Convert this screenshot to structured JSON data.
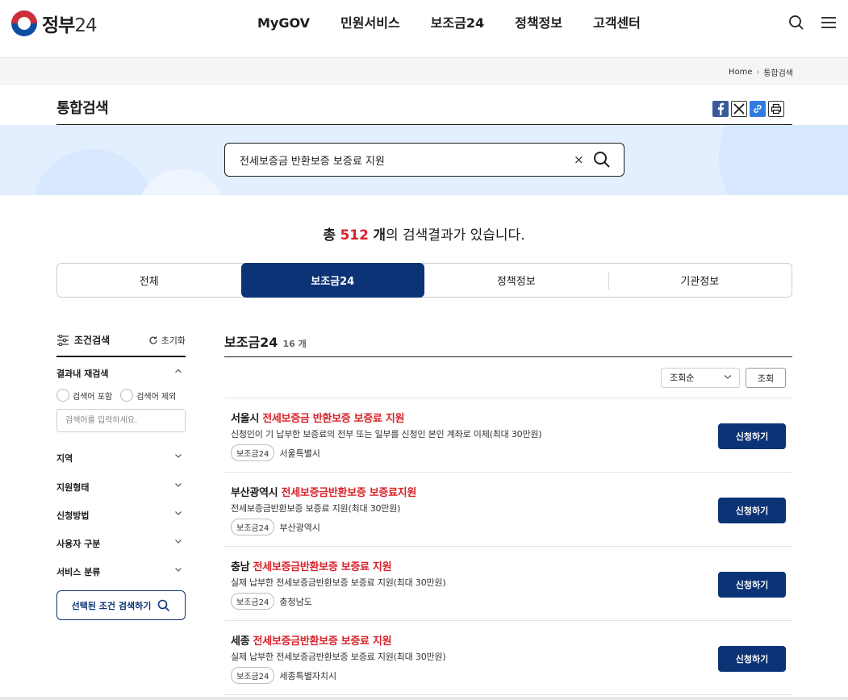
{
  "header": {
    "logo_text": "정부",
    "logo_num": "24",
    "nav": [
      "MyGOV",
      "민원서비스",
      "보조금24",
      "정책정보",
      "고객센터"
    ]
  },
  "breadcrumb": {
    "home": "Home",
    "current": "통합검색"
  },
  "page": {
    "title": "통합검색"
  },
  "search": {
    "query": "전세보증금 반환보증 보증료 지원",
    "clear": "×"
  },
  "result": {
    "prefix": "총",
    "count": "512",
    "unit": "개",
    "suffix": "의 검색결과가 있습니다."
  },
  "tabs": [
    {
      "label": "전체"
    },
    {
      "label": "보조금24"
    },
    {
      "label": "정책정보"
    },
    {
      "label": "기관정보"
    }
  ],
  "filter": {
    "title": "조건검색",
    "reset": "초기화",
    "research_title": "결과내 재검색",
    "include": "검색어 포함",
    "exclude": "검색어 제외",
    "placeholder": "검색어를 입력하세요.",
    "sections": [
      "지역",
      "지원형태",
      "신청방법",
      "사용자 구분",
      "서비스 분류"
    ],
    "submit": "선택된 조건 검색하기"
  },
  "results": {
    "title": "보조금24",
    "count": "16 개",
    "sort_value": "조회순",
    "sort_button": "조회",
    "items": [
      {
        "prefix": "서울시 ",
        "highlight": "전세보증금 반환보증 보증료 지원",
        "desc": "신청인이 기 납부한 보증료의 전부 또는 일부를 신청인 본인 계좌로 이체(최대 30만원)",
        "badge": "보조금24",
        "region": "서울특별시",
        "apply": "신청하기"
      },
      {
        "prefix": "부산광역시 ",
        "highlight": "전세보증금반환보증 보증료지원",
        "desc": "전세보증금반환보증 보증료 지원(최대 30만원)",
        "badge": "보조금24",
        "region": "부산광역시",
        "apply": "신청하기"
      },
      {
        "prefix": "충남 ",
        "highlight": "전세보증금반환보증 보증료 지원",
        "desc": "실제 납부한 전세보증금반환보증 보증료 지원(최대 30만원)",
        "badge": "보조금24",
        "region": "충청남도",
        "apply": "신청하기"
      },
      {
        "prefix": "세종 ",
        "highlight": "전세보증금반환보증 보증료 지원",
        "desc": "실제 납부한 전세보증금반환보증 보증료 지원(최대 30만원)",
        "badge": "보조금24",
        "region": "세종특별자치시",
        "apply": "신청하기"
      }
    ]
  },
  "colors": {
    "primary": "#0b3375",
    "highlight": "#d8232a",
    "band": "#e3efff"
  }
}
